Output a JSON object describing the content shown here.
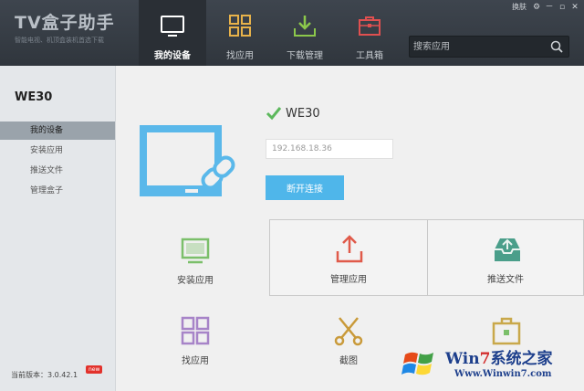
{
  "app": {
    "title": "TV盒子助手",
    "subtitle": "智能电视、机顶盒装机首选下载"
  },
  "window_controls": {
    "skin": "换肤",
    "settings": "⚙",
    "minimize": "－",
    "restore": "▫",
    "close": "✕"
  },
  "nav": [
    {
      "label": "我的设备",
      "icon": "monitor-icon",
      "active": true
    },
    {
      "label": "找应用",
      "icon": "grid-icon",
      "active": false
    },
    {
      "label": "下载管理",
      "icon": "download-icon",
      "active": false
    },
    {
      "label": "工具箱",
      "icon": "toolbox-icon",
      "active": false
    }
  ],
  "search": {
    "placeholder": "搜索应用"
  },
  "sidebar": {
    "device": "WE30",
    "items": [
      {
        "label": "我的设备",
        "active": true
      },
      {
        "label": "安装应用",
        "active": false
      },
      {
        "label": "推送文件",
        "active": false
      },
      {
        "label": "管理盒子",
        "active": false
      }
    ],
    "version": "当前版本：3.0.42.1",
    "badge": "new"
  },
  "device": {
    "name": "WE30",
    "ip": "192.168.18.36",
    "disconnect_label": "断开连接"
  },
  "tiles": [
    {
      "label": "安装应用",
      "icon": "tv-install-icon"
    },
    {
      "label": "管理应用",
      "icon": "upload-icon"
    },
    {
      "label": "推送文件",
      "icon": "inbox-icon"
    },
    {
      "label": "找应用",
      "icon": "grid-icon"
    },
    {
      "label": "截图",
      "icon": "scissors-icon"
    },
    {
      "label": "",
      "icon": "briefcase-icon"
    }
  ],
  "watermark": {
    "brand_prefix": "Win",
    "brand_seven": "7",
    "brand_suffix": "系统之家",
    "url": "Www.Winwin7.com"
  },
  "colors": {
    "accent": "#4fb6ea",
    "header": "#353b42",
    "check": "#5cb85c",
    "tile_green": "#7bbf6a",
    "tile_red": "#e05a4a",
    "tile_purple": "#a784c8",
    "tile_teal": "#4a9e8a",
    "tile_gold": "#c9a84a"
  }
}
